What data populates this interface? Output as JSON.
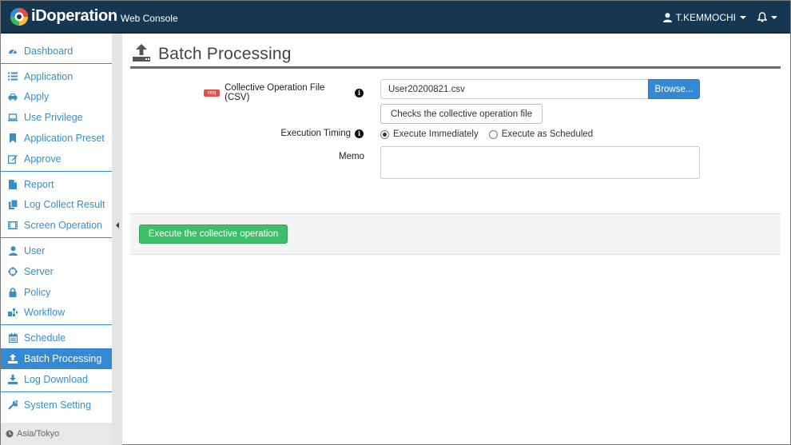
{
  "header": {
    "brand": "iDoperation",
    "brand_sub": "Web Console",
    "user_name": "T.KEMMOCHI"
  },
  "sidebar": {
    "groups": [
      [
        {
          "label": "Dashboard",
          "icon": "dashboard-icon"
        }
      ],
      [
        {
          "label": "Application",
          "icon": "list-icon"
        },
        {
          "label": "Apply",
          "icon": "car-icon"
        },
        {
          "label": "Use Privilege",
          "icon": "laptop-icon"
        },
        {
          "label": "Application Preset",
          "icon": "bookmark-icon"
        },
        {
          "label": "Approve",
          "icon": "edit-icon"
        }
      ],
      [
        {
          "label": "Report",
          "icon": "file-icon"
        },
        {
          "label": "Log Collect Result",
          "icon": "files-icon"
        },
        {
          "label": "Screen Operation",
          "icon": "film-icon"
        }
      ],
      [
        {
          "label": "User",
          "icon": "user-icon"
        },
        {
          "label": "Server",
          "icon": "crosshair-icon"
        },
        {
          "label": "Policy",
          "icon": "lock-icon"
        },
        {
          "label": "Workflow",
          "icon": "sitemap-icon"
        }
      ],
      [
        {
          "label": "Schedule",
          "icon": "calendar-icon"
        },
        {
          "label": "Batch Processing",
          "icon": "upload-icon",
          "active": true
        },
        {
          "label": "Log Download",
          "icon": "download-icon"
        }
      ],
      [
        {
          "label": "System Setting",
          "icon": "wrench-icon"
        }
      ]
    ],
    "timezone": "Asia/Tokyo"
  },
  "page": {
    "title": "Batch Processing"
  },
  "form": {
    "req_badge": "req",
    "file_label": "Collective Operation File (CSV)",
    "file_value": "User20200821.csv",
    "browse_label": "Browse...",
    "check_label": "Checks the collective operation file",
    "timing_label": "Execution Timing",
    "timing_options": [
      {
        "label": "Execute Immediately",
        "selected": true
      },
      {
        "label": "Execute as Scheduled",
        "selected": false
      }
    ],
    "memo_label": "Memo",
    "memo_value": ""
  },
  "actions": {
    "execute_label": "Execute the collective operation"
  },
  "colors": {
    "topbar": "#163752",
    "accent": "#3489d4",
    "success": "#3dbf6a",
    "req": "#d9534f"
  }
}
